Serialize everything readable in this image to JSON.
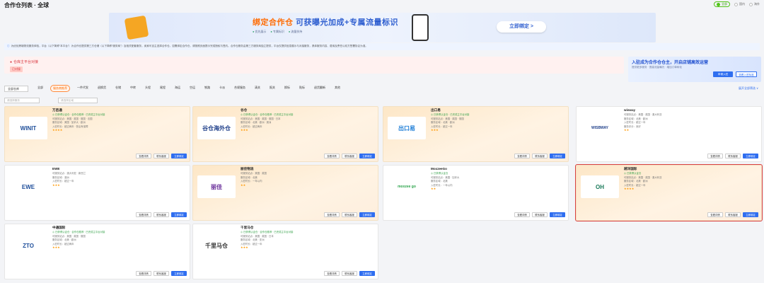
{
  "page": {
    "title": "合作仓列表 · 全球"
  },
  "top_radios": [
    "全部",
    "国内",
    "海外"
  ],
  "banner": {
    "headline_orange": "绑定合作仓",
    "headline_blue": "可获曝光加成+专属流量标识",
    "subs": [
      "优先展示",
      "专属标识",
      "流量扶持"
    ],
    "cta": "立即绑定 >"
  },
  "notice": {
    "text": "为优化跨境物流服务体验，平台（以下简称“本平台”）为合作仓提供第三方仓储（以下简称“服务商”）及相关配套服务，卖家可自主选择合作仓。如需绑定合作仓，请按照页面提示完成授权与签约。合作仓服务由第三方服务商独立提供，平台仅提供信息展示与对接服务，具体服务内容、费用及责任以双方签署协议为准。"
  },
  "alert": {
    "title": "仓库主平台对接",
    "tag": "已对接"
  },
  "apply": {
    "title": "入驻成为合作仓仓主，开启店铺高效运营",
    "sub": "提供更多服务 · 提高流量曝光 · 增加订单转化",
    "btn_primary": "申请入驻",
    "btn_secondary": "查看入驻标准"
  },
  "filters": {
    "select_value": "全部仓库",
    "chips": [
      "全部",
      "服务商推荐",
      "一件代发",
      "退换货",
      "仓储",
      "中转",
      "头程",
      "尾程",
      "海运",
      "空运",
      "铁路",
      "卡派",
      "合规服务",
      "清关",
      "报关",
      "换标",
      "贴标",
      "退货翻新",
      "其他"
    ],
    "active_index": 1,
    "right_link": "展开全部筛选 ∨",
    "search1": "请选择服务",
    "search2": "请选择区域"
  },
  "card_buttons": {
    "detail": "查看详情",
    "contact": "联系客服",
    "bind": "立即绑定"
  },
  "cards": [
    {
      "name": "万邑通",
      "logo": "WINIT",
      "logo_color": "#1e4e9a",
      "lines": [
        "◎ 已获得认证仓 · 合作仓推荐 · 已完成主平台对接",
        "可服务站点：美国 · 英国 · 德国 · 法国",
        "服务区域：美国 · 加拿大 · 欧洲",
        "入驻时长：超过两年 · 售后有保障"
      ],
      "rating": "★★★★",
      "style": "orange"
    },
    {
      "name": "谷仓",
      "logo": "谷仓海外仓",
      "logo_color": "#1f3f8a",
      "lines": [
        "◎ 已获得认证仓 · 合作仓推荐 · 已完成主平台对接",
        "可服务站点：美国 · 英国 · 德国 · 日本",
        "服务区域：北美 · 欧洲 · 澳洲",
        "入驻时长：超过两年"
      ],
      "rating": "★★★",
      "style": "orange"
    },
    {
      "name": "出口易",
      "logo": "出口易",
      "logo_color": "#1a7bd6",
      "lines": [
        "◎ 已获得认证仓 · 已完成主平台对接",
        "可服务站点：美国 · 英国 · 德国",
        "服务区域：北美 · 欧洲",
        "入驻时长：超过一年"
      ],
      "rating": "★★★",
      "style": "orange"
    },
    {
      "name": "wisway",
      "logo": "WISBWAY",
      "logo_color": "#1f3f8a",
      "lines": [
        "可服务站点：美国 · 英国 · 澳大利亚",
        "服务区域：北美 · 欧洲",
        "入驻时长：超过一年",
        "服务评分：良好"
      ],
      "rating": "★★",
      "style": "white"
    },
    {
      "name": "EWE",
      "logo": "EWE",
      "logo_color": "#1e4e9a",
      "lines": [
        "可服务站点：澳大利亚 · 新西兰",
        "服务区域：澳洲",
        "入驻时长：超过一年"
      ],
      "rating": "★★★",
      "style": "white"
    },
    {
      "name": "丽佳物流",
      "logo": "丽佳",
      "logo_color": "#6a2f9a",
      "lines": [
        "可服务站点：美国 · 英国",
        "服务区域：北美",
        "入驻时长：一年以内"
      ],
      "rating": "★★",
      "style": "orange"
    },
    {
      "name": "MoxzeeGo",
      "logo": "moxzee go",
      "logo_color": "#2aa34a",
      "lines": [
        "◎ 已获得认证仓",
        "可服务站点：美国 · 加拿大",
        "服务区域：北美",
        "入驻时长：一年以内"
      ],
      "rating": "★★",
      "style": "white"
    },
    {
      "name": "越洋国际",
      "logo": "OH",
      "logo_color": "#1a7a5a",
      "lines": [
        "◎ 已获得认证仓",
        "可服务站点：美国 · 英国 · 澳大利亚",
        "服务区域：北美 · 欧洲",
        "入驻时长：超过一年"
      ],
      "rating": "★★★★",
      "style": "orange",
      "selected": true
    },
    {
      "name": "中通国际",
      "logo": "ZTO",
      "logo_color": "#1e4e9a",
      "lines": [
        "◎ 已获得认证仓 · 合作仓推荐 · 已完成主平台对接",
        "可服务站点：美国 · 英国 · 德国",
        "服务区域：北美 · 欧洲",
        "入驻时长：超过两年"
      ],
      "rating": "★★★",
      "style": "white"
    },
    {
      "name": "千里马仓",
      "logo": "千里马仓",
      "logo_color": "#333333",
      "lines": [
        "◎ 已获得认证仓 · 合作仓推荐 · 已完成主平台对接",
        "可服务站点：美国 · 英国 · 日本",
        "服务区域：北美 · 亚洲",
        "入驻时长：超过一年"
      ],
      "rating": "★★★",
      "style": "white"
    }
  ]
}
